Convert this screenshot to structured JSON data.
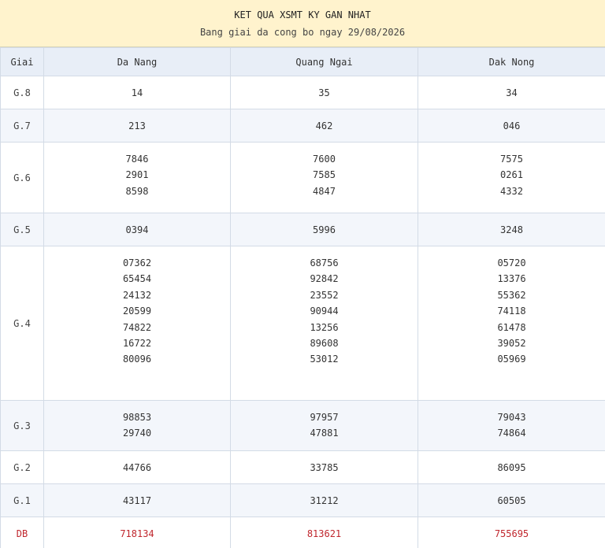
{
  "header": {
    "title": "KET QUA XSMT KY GAN NHAT",
    "subtitle": "Bang giai da cong bo ngay 29/08/2026"
  },
  "columns": [
    "Giai",
    "Da Nang",
    "Quang Ngai",
    "Dak Nong"
  ],
  "rows": [
    {
      "prize": "G.8",
      "cells": [
        [
          "14"
        ],
        [
          "35"
        ],
        [
          "34"
        ]
      ]
    },
    {
      "prize": "G.7",
      "cells": [
        [
          "213"
        ],
        [
          "462"
        ],
        [
          "046"
        ]
      ]
    },
    {
      "prize": "G.6",
      "cells": [
        [
          "7846",
          "2901",
          "8598"
        ],
        [
          "7600",
          "7585",
          "4847"
        ],
        [
          "7575",
          "0261",
          "4332"
        ]
      ]
    },
    {
      "prize": "G.5",
      "cells": [
        [
          "0394"
        ],
        [
          "5996"
        ],
        [
          "3248"
        ]
      ]
    },
    {
      "prize": "G.4",
      "cells": [
        [
          "07362",
          "65454",
          "24132",
          "20599",
          "74822",
          "16722",
          "80096"
        ],
        [
          "68756",
          "92842",
          "23552",
          "90944",
          "13256",
          "89608",
          "53012"
        ],
        [
          "05720",
          "13376",
          "55362",
          "74118",
          "61478",
          "39052",
          "05969"
        ]
      ]
    },
    {
      "prize": "G.3",
      "cells": [
        [
          "98853",
          "29740"
        ],
        [
          "97957",
          "47881"
        ],
        [
          "79043",
          "74864"
        ]
      ]
    },
    {
      "prize": "G.2",
      "cells": [
        [
          "44766"
        ],
        [
          "33785"
        ],
        [
          "86095"
        ]
      ]
    },
    {
      "prize": "G.1",
      "cells": [
        [
          "43117"
        ],
        [
          "31212"
        ],
        [
          "60505"
        ]
      ]
    },
    {
      "prize": "DB",
      "cells": [
        [
          "718134"
        ],
        [
          "813621"
        ],
        [
          "755695"
        ]
      ]
    }
  ],
  "colors": {
    "header_bg": "#fff3cd",
    "column_header_bg": "#e8eef7",
    "shaded_row_bg": "#f3f6fb",
    "special_prize_color": "#c0262d"
  }
}
